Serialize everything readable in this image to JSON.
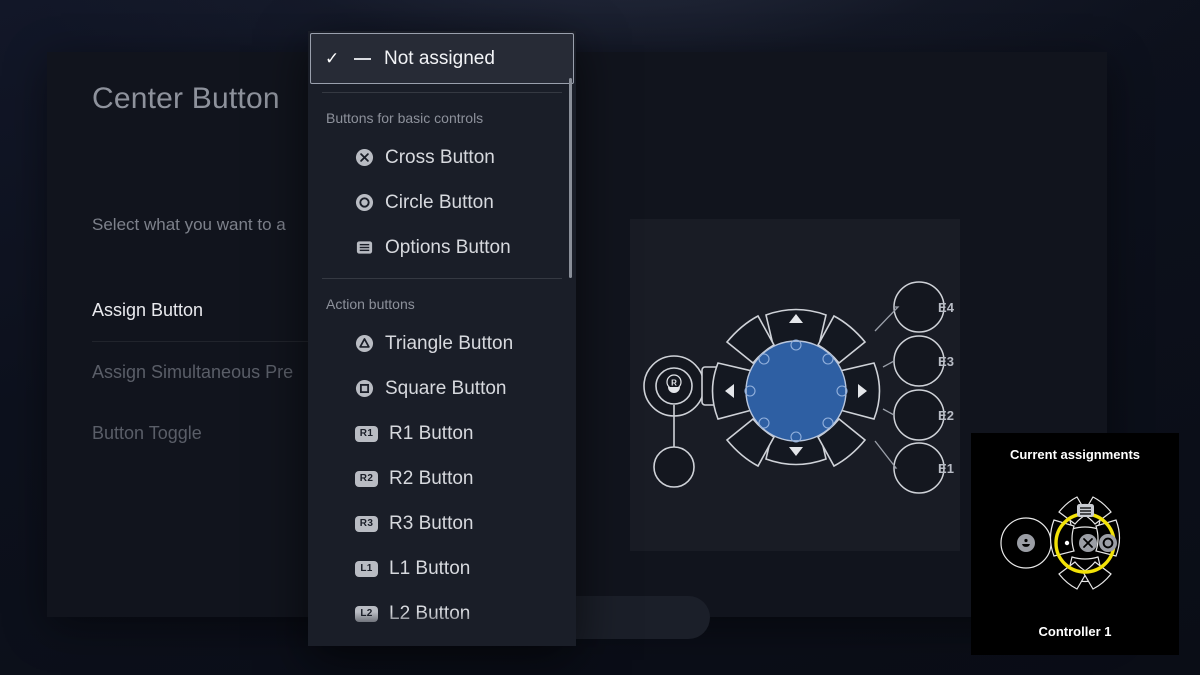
{
  "page": {
    "title": "Center Button",
    "subtitle": "Select what you want to a"
  },
  "options": [
    {
      "label": "Assign Button",
      "state": "selected"
    },
    {
      "label": "Assign Simultaneous Pre",
      "state": "dim"
    },
    {
      "label": "Button Toggle",
      "state": "dim"
    }
  ],
  "dropdown": {
    "selected": {
      "label": "Not assigned",
      "check": "✓",
      "icon": "dash-icon"
    },
    "groups": [
      {
        "title": "Buttons for basic controls",
        "items": [
          {
            "label": "Cross Button",
            "icon": "cross-button-icon",
            "icon_type": "glyph"
          },
          {
            "label": "Circle Button",
            "icon": "circle-button-icon",
            "icon_type": "glyph"
          },
          {
            "label": "Options Button",
            "icon": "options-button-icon",
            "icon_type": "glyph"
          }
        ]
      },
      {
        "title": "Action buttons",
        "items": [
          {
            "label": "Triangle Button",
            "icon": "triangle-button-icon",
            "icon_type": "glyph"
          },
          {
            "label": "Square Button",
            "icon": "square-button-icon",
            "icon_type": "glyph"
          },
          {
            "label": "R1 Button",
            "icon": "r1-badge-icon",
            "icon_type": "badge",
            "badge": "R1"
          },
          {
            "label": "R2 Button",
            "icon": "r2-badge-icon",
            "icon_type": "badge",
            "badge": "R2"
          },
          {
            "label": "R3 Button",
            "icon": "r3-badge-icon",
            "icon_type": "badge",
            "badge": "R3"
          },
          {
            "label": "L1 Button",
            "icon": "l1-badge-icon",
            "icon_type": "badge",
            "badge": "L1"
          },
          {
            "label": "L2 Button",
            "icon": "l2-badge-icon",
            "icon_type": "badge",
            "badge": "L2"
          }
        ]
      }
    ]
  },
  "diagram": {
    "expansion_labels": [
      "E4",
      "E3",
      "E2",
      "E1"
    ],
    "center_color": "#2e5fa3",
    "stick_label": "R"
  },
  "assignments": {
    "title": "Current assignments",
    "footer": "Controller 1",
    "highlight_color": "#f2e207",
    "center_icon": "cross-button-icon",
    "top_icon": "options-button-icon",
    "right_icon": "circle-button-icon",
    "left_icon": "stick-icon"
  }
}
